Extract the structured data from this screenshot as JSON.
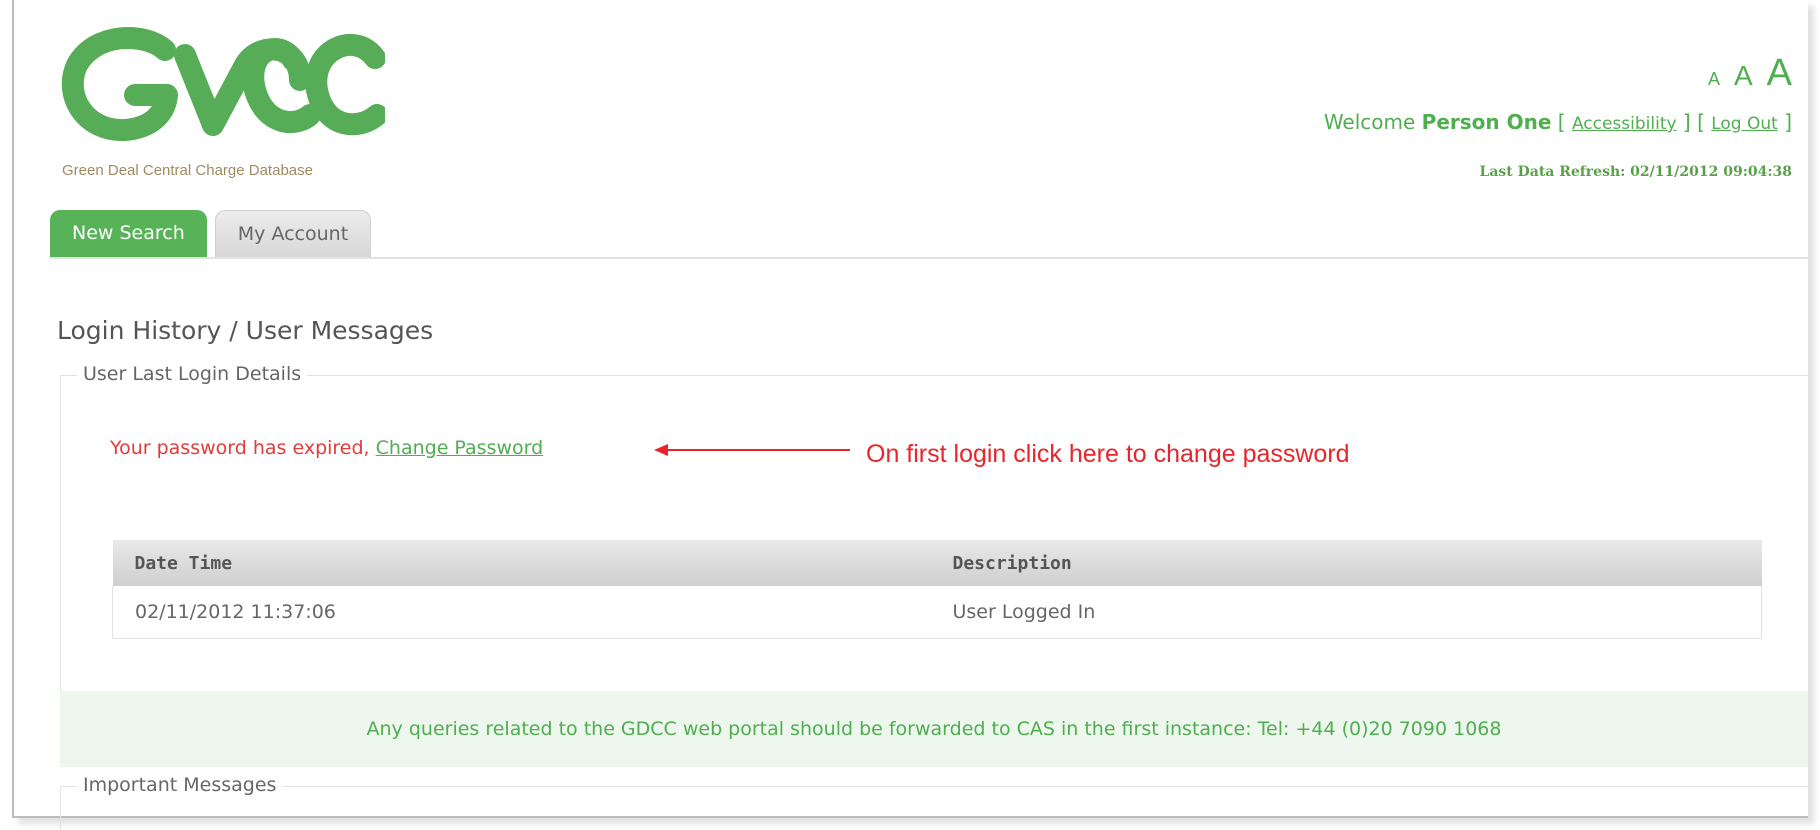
{
  "logo": {
    "wordmark": "GDCC",
    "tagline": "Green Deal Central Charge Database"
  },
  "font_size_controls": {
    "small": "A",
    "medium": "A",
    "large": "A"
  },
  "header": {
    "welcome_prefix": "Welcome",
    "user_name": "Person One",
    "accessibility_link": "Accessibility",
    "logout_link": "Log Out",
    "last_refresh": "Last Data Refresh: 02/11/2012 09:04:38"
  },
  "tabs": [
    {
      "label": "New Search",
      "active": true
    },
    {
      "label": "My Account",
      "active": false
    }
  ],
  "page_title": "Login History / User Messages",
  "login_details": {
    "legend": "User Last Login Details",
    "expired_text": "Your password has expired,",
    "change_password_link": "Change Password"
  },
  "annotation": {
    "text": "On first login click here to change password"
  },
  "history_table": {
    "headers": [
      "Date Time",
      "Description"
    ],
    "rows": [
      [
        "02/11/2012 11:37:06",
        "User Logged In"
      ]
    ]
  },
  "notice": "Any queries related to the GDCC web portal should be forwarded to CAS in the first instance: Tel: +44 (0)20 7090 1068",
  "important_messages": {
    "legend": "Important Messages"
  },
  "colors": {
    "brand_green": "#4fae4f",
    "alert_red": "#e23b3b",
    "annotation_red": "#e8252a",
    "tagline": "#a08a62"
  }
}
